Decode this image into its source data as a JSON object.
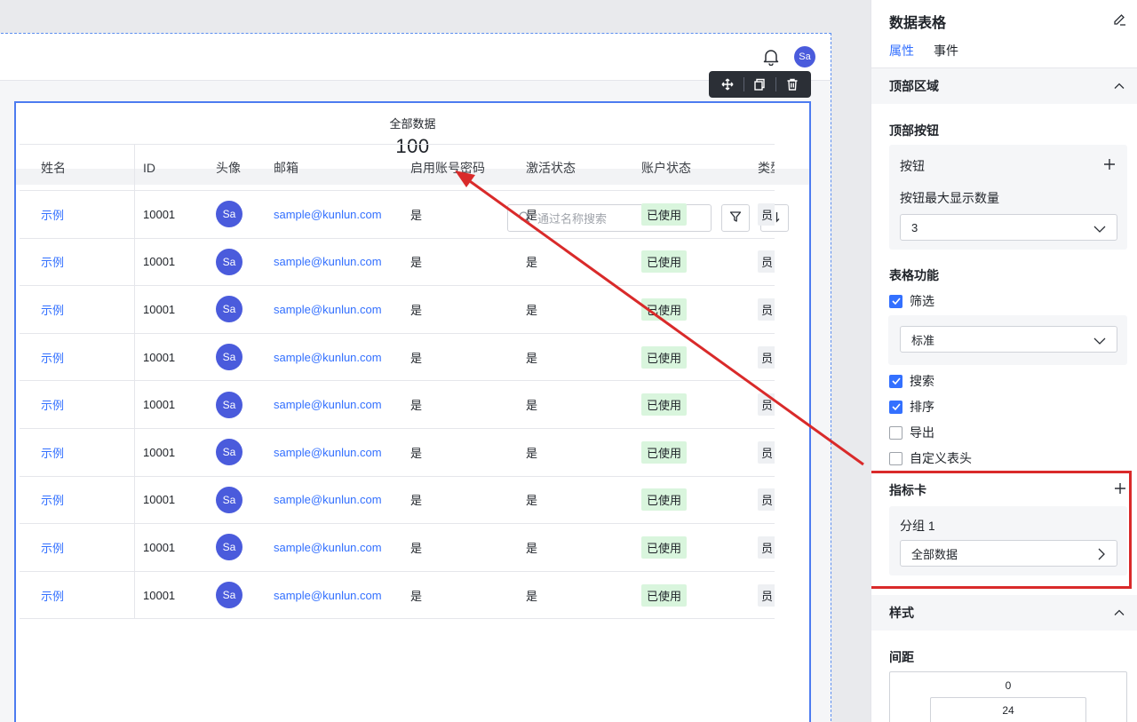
{
  "canvas": {
    "metric": {
      "label": "全部数据",
      "value": "100"
    },
    "search": {
      "placeholder": "通过名称搜索"
    },
    "table": {
      "columns": [
        "姓名",
        "ID",
        "头像",
        "邮箱",
        "启用账号密码",
        "激活状态",
        "账户状态",
        "类型"
      ],
      "rows": [
        [
          "示例",
          "10001",
          "Sa",
          "sample@kunlun.com",
          "是",
          "是",
          "已使用",
          "员"
        ],
        [
          "示例",
          "10001",
          "Sa",
          "sample@kunlun.com",
          "是",
          "是",
          "已使用",
          "员"
        ],
        [
          "示例",
          "10001",
          "Sa",
          "sample@kunlun.com",
          "是",
          "是",
          "已使用",
          "员"
        ],
        [
          "示例",
          "10001",
          "Sa",
          "sample@kunlun.com",
          "是",
          "是",
          "已使用",
          "员"
        ],
        [
          "示例",
          "10001",
          "Sa",
          "sample@kunlun.com",
          "是",
          "是",
          "已使用",
          "员"
        ],
        [
          "示例",
          "10001",
          "Sa",
          "sample@kunlun.com",
          "是",
          "是",
          "已使用",
          "员"
        ],
        [
          "示例",
          "10001",
          "Sa",
          "sample@kunlun.com",
          "是",
          "是",
          "已使用",
          "员"
        ],
        [
          "示例",
          "10001",
          "Sa",
          "sample@kunlun.com",
          "是",
          "是",
          "已使用",
          "员"
        ],
        [
          "示例",
          "10001",
          "Sa",
          "sample@kunlun.com",
          "是",
          "是",
          "已使用",
          "员"
        ]
      ]
    },
    "user_avatar": "Sa"
  },
  "panel": {
    "title": "数据表格",
    "tabs": [
      "属性",
      "事件"
    ],
    "sections": {
      "top_area": "顶部区域",
      "top_buttons": "顶部按钮",
      "button_label": "按钮",
      "max_buttons_label": "按钮最大显示数量",
      "max_buttons_value": "3",
      "table_features": "表格功能",
      "filter": "筛选",
      "filter_mode": "标准",
      "search": "搜索",
      "sort": "排序",
      "export": "导出",
      "custom_header": "自定义表头",
      "metric_card": "指标卡",
      "group": "分组 1",
      "group_item": "全部数据",
      "style": "样式",
      "spacing": "间距",
      "spacing_outer": "0",
      "spacing_inner": "24"
    },
    "checks": {
      "filter": true,
      "search": true,
      "sort": true,
      "export": false,
      "custom_header": false
    }
  },
  "colors": {
    "accent": "#3370ff",
    "highlight": "#d92a2a",
    "avatar": "#4a5bdc",
    "tag_green": "#d9f5dd"
  }
}
